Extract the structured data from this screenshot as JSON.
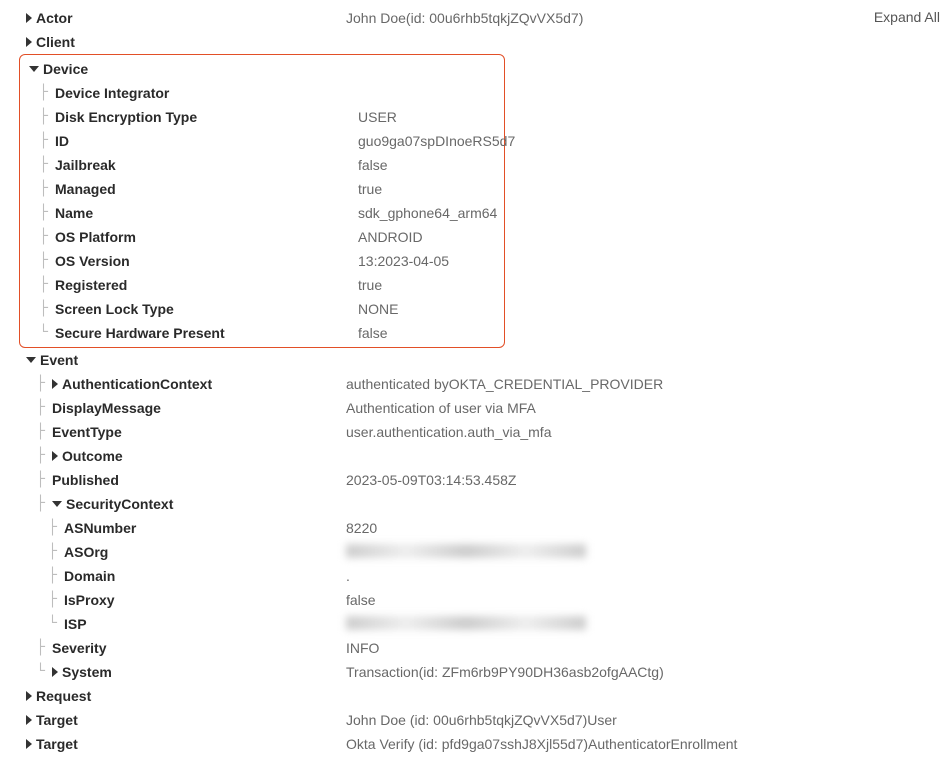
{
  "controls": {
    "expand_all": "Expand All"
  },
  "sections": {
    "actor": {
      "label": "Actor",
      "value": "John Doe(id: 00u6rhb5tqkjZQvVX5d7)"
    },
    "client": {
      "label": "Client",
      "value": ""
    },
    "device": {
      "label": "Device",
      "value": ""
    },
    "event": {
      "label": "Event",
      "value": ""
    },
    "request": {
      "label": "Request",
      "value": ""
    },
    "target1": {
      "label": "Target",
      "value": "John Doe (id: 00u6rhb5tqkjZQvVX5d7)User"
    },
    "target2": {
      "label": "Target",
      "value": "Okta Verify (id: pfd9ga07sshJ8Xjl55d7)AuthenticatorEnrollment"
    }
  },
  "device": {
    "items": {
      "integrator": {
        "label": "Device Integrator",
        "value": ""
      },
      "diskEnc": {
        "label": "Disk Encryption Type",
        "value": "USER"
      },
      "id": {
        "label": "ID",
        "value": "guo9ga07spDInoeRS5d7"
      },
      "jailbreak": {
        "label": "Jailbreak",
        "value": "false"
      },
      "managed": {
        "label": "Managed",
        "value": "true"
      },
      "name": {
        "label": "Name",
        "value": "sdk_gphone64_arm64"
      },
      "osPlatform": {
        "label": "OS Platform",
        "value": "ANDROID"
      },
      "osVersion": {
        "label": "OS Version",
        "value": "13:2023-04-05"
      },
      "registered": {
        "label": "Registered",
        "value": "true"
      },
      "screenLock": {
        "label": "Screen Lock Type",
        "value": "NONE"
      },
      "secureHw": {
        "label": "Secure Hardware Present",
        "value": "false"
      }
    }
  },
  "event": {
    "items": {
      "authContext": {
        "label": "AuthenticationContext",
        "value": "authenticated byOKTA_CREDENTIAL_PROVIDER"
      },
      "displayMsg": {
        "label": "DisplayMessage",
        "value": "Authentication of user via MFA"
      },
      "eventType": {
        "label": "EventType",
        "value": "user.authentication.auth_via_mfa"
      },
      "outcome": {
        "label": "Outcome",
        "value": ""
      },
      "published": {
        "label": "Published",
        "value": "2023-05-09T03:14:53.458Z"
      },
      "secContext": {
        "label": "SecurityContext",
        "value": ""
      },
      "severity": {
        "label": "Severity",
        "value": "INFO"
      },
      "system": {
        "label": "System",
        "value": "Transaction(id: ZFm6rb9PY90DH36asb2ofgAACtg)"
      }
    },
    "securityContext": {
      "asNumber": {
        "label": "ASNumber",
        "value": "8220"
      },
      "asOrg": {
        "label": "ASOrg",
        "value": ""
      },
      "domain": {
        "label": "Domain",
        "value": "."
      },
      "isProxy": {
        "label": "IsProxy",
        "value": "false"
      },
      "isp": {
        "label": "ISP",
        "value": ""
      }
    }
  }
}
